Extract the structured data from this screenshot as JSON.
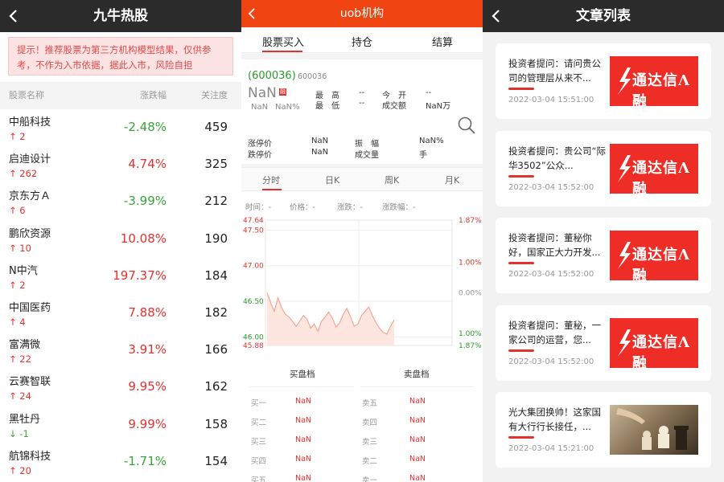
{
  "panel1": {
    "title": "九牛热股",
    "notice": "提示！推荐股票为第三方机构模型结果，仅供参考，不作为入市依据，据此入市，风险自担",
    "columns": {
      "name": "股票名称",
      "change": "涨跌幅",
      "attention": "关注度"
    },
    "stocks": [
      {
        "name": "中船科技",
        "count": "↑ 2",
        "change": "-2.48%",
        "attention": "459",
        "dir": "down"
      },
      {
        "name": "启迪设计",
        "count": "↑ 262",
        "change": "4.74%",
        "attention": "325",
        "dir": "up"
      },
      {
        "name": "京东方Ａ",
        "count": "↑ 6",
        "change": "-3.99%",
        "attention": "212",
        "dir": "down"
      },
      {
        "name": "鹏欣资源",
        "count": "↑ 10",
        "change": "10.08%",
        "attention": "190",
        "dir": "up"
      },
      {
        "name": "N中汽",
        "count": "↑ 2",
        "change": "197.37%",
        "attention": "184",
        "dir": "up"
      },
      {
        "name": "中国医药",
        "count": "↑ 4",
        "change": "7.88%",
        "attention": "182",
        "dir": "up"
      },
      {
        "name": "富满微",
        "count": "↑ 22",
        "change": "3.91%",
        "attention": "166",
        "dir": "up"
      },
      {
        "name": "云赛智联",
        "count": "↑ 24",
        "change": "9.95%",
        "attention": "162",
        "dir": "up"
      },
      {
        "name": "黑牡丹",
        "count": "↓ -1",
        "change": "9.99%",
        "attention": "158",
        "dir": "up"
      },
      {
        "name": "航锦科技",
        "count": "↑ 20",
        "change": "-1.71%",
        "attention": "154",
        "dir": "down"
      }
    ]
  },
  "panel2": {
    "title": "uob机构",
    "tabs": [
      "股票买入",
      "持仓",
      "结算"
    ],
    "code": "(600036)",
    "code_small": "600036",
    "price": "NaN",
    "badge": "融",
    "change_abs": "NaN",
    "change_pct": "NaN%",
    "labels": {
      "high": "最　高",
      "low": "最　低",
      "open": "今　开",
      "turnover": "成交额",
      "limit_up": "涨停价",
      "limit_down": "跌停价",
      "amplitude": "振　幅",
      "volume": "成交量"
    },
    "values": {
      "high": "--",
      "low": "--",
      "open": "--",
      "turnover": "NaN万",
      "limit_up": "NaN",
      "limit_down": "NaN",
      "amplitude": "NaN%",
      "volume": "手"
    },
    "chart_tabs": [
      "分时",
      "日K",
      "周K",
      "月K"
    ],
    "info": {
      "time": "时间：-",
      "price": "价格：-",
      "change": "涨跌：-",
      "pct": "涨跌幅：-"
    },
    "buy_title": "买盘档",
    "sell_title": "卖盘档",
    "buy_levels": [
      {
        "label": "买一",
        "value": "NaN"
      },
      {
        "label": "买二",
        "value": "NaN"
      },
      {
        "label": "买三",
        "value": "NaN"
      },
      {
        "label": "买四",
        "value": "NaN"
      },
      {
        "label": "买五",
        "value": "NaN"
      }
    ],
    "sell_levels": [
      {
        "label": "卖五",
        "value": "NaN"
      },
      {
        "label": "卖四",
        "value": "NaN"
      },
      {
        "label": "卖三",
        "value": "NaN"
      },
      {
        "label": "卖二",
        "value": "NaN"
      },
      {
        "label": "卖一",
        "value": "NaN"
      }
    ],
    "chart_data": {
      "type": "area",
      "y_left_ticks": [
        "47.64",
        "47.50",
        "47.00",
        "46.50",
        "46.00",
        "45.88"
      ],
      "y_right_ticks": [
        "1.87%",
        "1.00%",
        "0.00%",
        "1.00%",
        "1.87%"
      ],
      "ylim": [
        45.88,
        47.64
      ],
      "y": [
        46.62,
        46.48,
        46.36,
        46.55,
        46.41,
        46.32,
        46.28,
        46.22,
        46.15,
        46.22,
        46.3,
        46.25,
        46.12,
        46.18,
        46.08,
        46.22,
        46.28,
        46.35,
        46.26,
        46.14,
        46.2,
        46.32,
        46.4,
        46.28,
        46.15,
        46.18,
        46.3,
        46.36,
        46.42,
        46.3,
        46.2,
        46.12,
        46.06,
        46.04,
        46.15,
        46.24
      ],
      "colors": {
        "line": "#f59a86",
        "fill": "#fde6e0"
      }
    }
  },
  "panel3": {
    "title": "文章列表",
    "logo_text": "通达信Λ融",
    "articles": [
      {
        "title": "投资者提问：请问贵公司的管理层从来不...",
        "date": "2022-03-04 15:51:00",
        "thumb": "logo"
      },
      {
        "title": "投资者提问：贵公司“际华3502”公众...",
        "date": "2022-03-04 15:52:00",
        "thumb": "logo"
      },
      {
        "title": "投资者提问：董秘你好，国家正大力开发...",
        "date": "2022-03-04 15:52:00",
        "thumb": "logo"
      },
      {
        "title": "投资者提问：董秘，一家公司的运营，您...",
        "date": "2022-03-04 15:52:00",
        "thumb": "logo"
      },
      {
        "title": "光大集团换帅！这家国有大行行长接任，...",
        "date": "2022-03-04 15:21:00",
        "thumb": "chess"
      }
    ]
  },
  "colors": {
    "red": "#e3322e",
    "green": "#3aa33a",
    "header_dark": "#2b2b2b",
    "header_orange": "#f04412"
  }
}
